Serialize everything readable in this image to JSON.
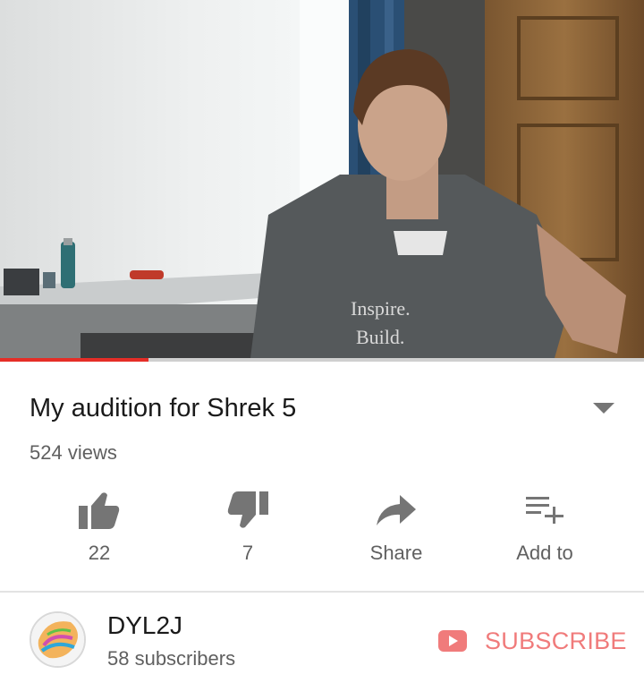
{
  "video": {
    "progress": 0.23,
    "shirt_text_line1": "Inspire.",
    "shirt_text_line2": "Build."
  },
  "info": {
    "title": "My audition for Shrek 5",
    "views": "524 views"
  },
  "actions": {
    "like_count": "22",
    "dislike_count": "7",
    "share_label": "Share",
    "add_to_label": "Add to"
  },
  "channel": {
    "name": "DYL2J",
    "subscribers": "58 subscribers",
    "subscribe_label": "SUBSCRIBE"
  },
  "colors": {
    "accent_red": "#e52d27",
    "subscribe_text": "#f07b7b",
    "icon_gray": "#757575"
  },
  "icons": [
    "thumb-up-icon",
    "thumb-down-icon",
    "share-icon",
    "playlist-add-icon",
    "youtube-icon",
    "chevron-down-icon"
  ]
}
